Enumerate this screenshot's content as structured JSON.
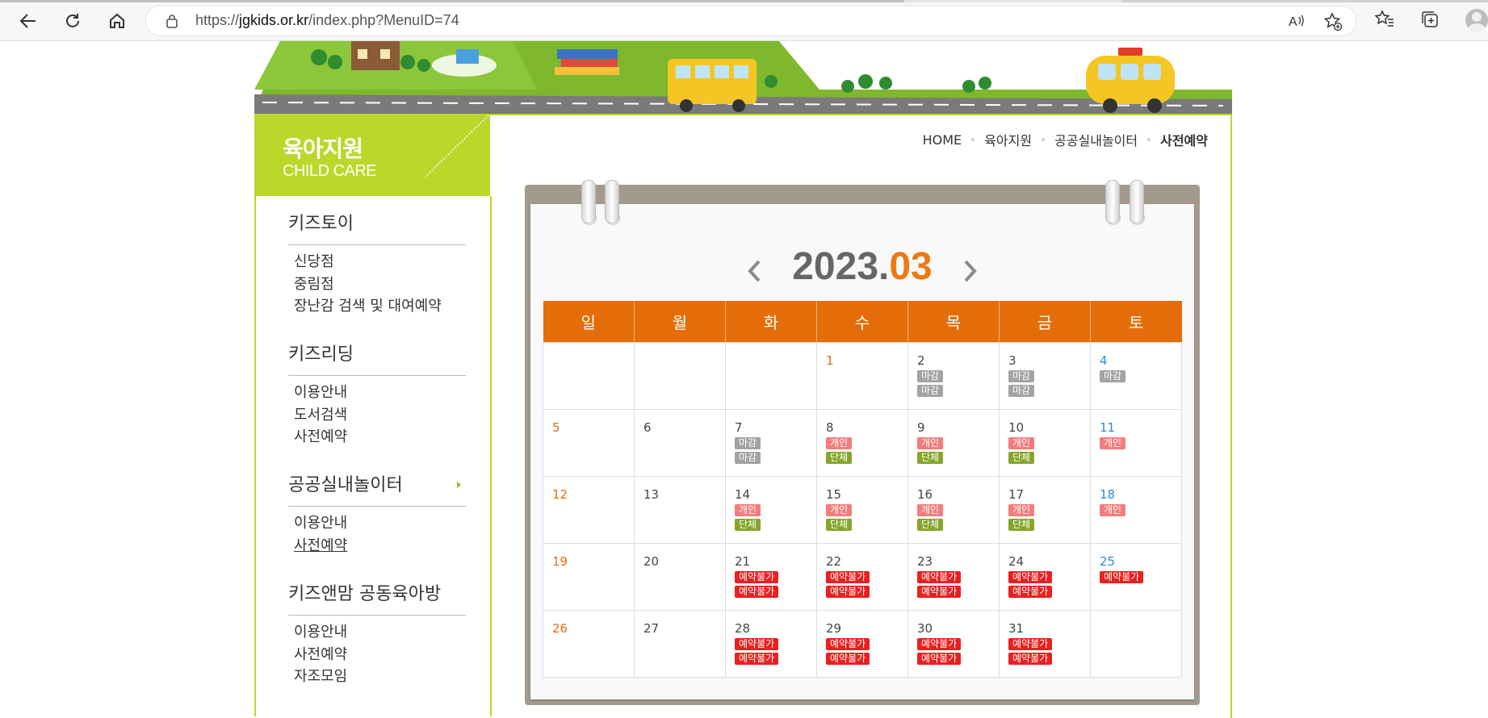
{
  "browser": {
    "url_prefix": "https://",
    "url_host": "jgkids.or.kr",
    "url_path": "/index.php?MenuID=74"
  },
  "sidebar": {
    "title_ko": "육아지원",
    "title_en": "CHILD CARE",
    "groups": [
      {
        "label": "키즈토이",
        "items": [
          "신당점",
          "중림점",
          "장난감 검색 및 대여예약"
        ]
      },
      {
        "label": "키즈리딩",
        "items": [
          "이용안내",
          "도서검색",
          "사전예약"
        ]
      },
      {
        "label": "공공실내놀이터",
        "items": [
          "이용안내",
          "사전예약"
        ]
      },
      {
        "label": "키즈앤맘 공동육아방",
        "items": [
          "이용안내",
          "사전예약",
          "자조모임"
        ]
      }
    ]
  },
  "breadcrumb": [
    "HOME",
    "육아지원",
    "공공실내놀이터",
    "사전예약"
  ],
  "calendar": {
    "year": "2023.",
    "month": "03",
    "weekdays": [
      "일",
      "월",
      "화",
      "수",
      "목",
      "금",
      "토"
    ],
    "weeks": [
      [
        {
          "day": ""
        },
        {
          "day": ""
        },
        {
          "day": ""
        },
        {
          "day": "1",
          "style": "red"
        },
        {
          "day": "2",
          "tags": [
            {
              "text": "마감",
              "color": "gray"
            },
            {
              "text": "마감",
              "color": "gray"
            }
          ]
        },
        {
          "day": "3",
          "tags": [
            {
              "text": "마감",
              "color": "gray"
            },
            {
              "text": "마감",
              "color": "gray"
            }
          ]
        },
        {
          "day": "4",
          "style": "sat",
          "tags": [
            {
              "text": "마감",
              "color": "gray"
            }
          ]
        }
      ],
      [
        {
          "day": "5",
          "style": "sun"
        },
        {
          "day": "6"
        },
        {
          "day": "7",
          "tags": [
            {
              "text": "마감",
              "color": "gray"
            },
            {
              "text": "마감",
              "color": "gray"
            }
          ]
        },
        {
          "day": "8",
          "tags": [
            {
              "text": "개인",
              "color": "pink"
            },
            {
              "text": "단체",
              "color": "green"
            }
          ]
        },
        {
          "day": "9",
          "tags": [
            {
              "text": "개인",
              "color": "pink"
            },
            {
              "text": "단체",
              "color": "green"
            }
          ]
        },
        {
          "day": "10",
          "tags": [
            {
              "text": "개인",
              "color": "pink"
            },
            {
              "text": "단체",
              "color": "green"
            }
          ]
        },
        {
          "day": "11",
          "style": "sat",
          "tags": [
            {
              "text": "개인",
              "color": "pink"
            }
          ]
        }
      ],
      [
        {
          "day": "12",
          "style": "sun"
        },
        {
          "day": "13"
        },
        {
          "day": "14",
          "tags": [
            {
              "text": "개인",
              "color": "pink"
            },
            {
              "text": "단체",
              "color": "green"
            }
          ]
        },
        {
          "day": "15",
          "tags": [
            {
              "text": "개인",
              "color": "pink"
            },
            {
              "text": "단체",
              "color": "green"
            }
          ]
        },
        {
          "day": "16",
          "tags": [
            {
              "text": "개인",
              "color": "pink"
            },
            {
              "text": "단체",
              "color": "green"
            }
          ]
        },
        {
          "day": "17",
          "tags": [
            {
              "text": "개인",
              "color": "pink"
            },
            {
              "text": "단체",
              "color": "green"
            }
          ]
        },
        {
          "day": "18",
          "style": "sat",
          "tags": [
            {
              "text": "개인",
              "color": "pink"
            }
          ]
        }
      ],
      [
        {
          "day": "19",
          "style": "sun"
        },
        {
          "day": "20"
        },
        {
          "day": "21",
          "tags": [
            {
              "text": "예약불가",
              "color": "red"
            },
            {
              "text": "예약불가",
              "color": "red"
            }
          ]
        },
        {
          "day": "22",
          "tags": [
            {
              "text": "예약불가",
              "color": "red"
            },
            {
              "text": "예약불가",
              "color": "red"
            }
          ]
        },
        {
          "day": "23",
          "tags": [
            {
              "text": "예약불가",
              "color": "red"
            },
            {
              "text": "예약불가",
              "color": "red"
            }
          ]
        },
        {
          "day": "24",
          "tags": [
            {
              "text": "예약불가",
              "color": "red"
            },
            {
              "text": "예약불가",
              "color": "red"
            }
          ]
        },
        {
          "day": "25",
          "style": "sat",
          "tags": [
            {
              "text": "예약불가",
              "color": "red"
            }
          ]
        }
      ],
      [
        {
          "day": "26",
          "style": "sun"
        },
        {
          "day": "27"
        },
        {
          "day": "28",
          "tags": [
            {
              "text": "예약불가",
              "color": "red"
            },
            {
              "text": "예약불가",
              "color": "red"
            }
          ]
        },
        {
          "day": "29",
          "tags": [
            {
              "text": "예약불가",
              "color": "red"
            },
            {
              "text": "예약불가",
              "color": "red"
            }
          ]
        },
        {
          "day": "30",
          "tags": [
            {
              "text": "예약불가",
              "color": "red"
            },
            {
              "text": "예약불가",
              "color": "red"
            }
          ]
        },
        {
          "day": "31",
          "tags": [
            {
              "text": "예약불가",
              "color": "red"
            },
            {
              "text": "예약불가",
              "color": "red"
            }
          ]
        },
        {
          "day": ""
        }
      ]
    ]
  },
  "colors": {
    "accent_green": "#bdd62a",
    "header_orange": "#e46d09",
    "month_orange": "#f07811",
    "tag_gray": "#a3a3a3",
    "tag_pink": "#f47c7c",
    "tag_green": "#86a52a",
    "tag_red": "#ea1f1f"
  }
}
